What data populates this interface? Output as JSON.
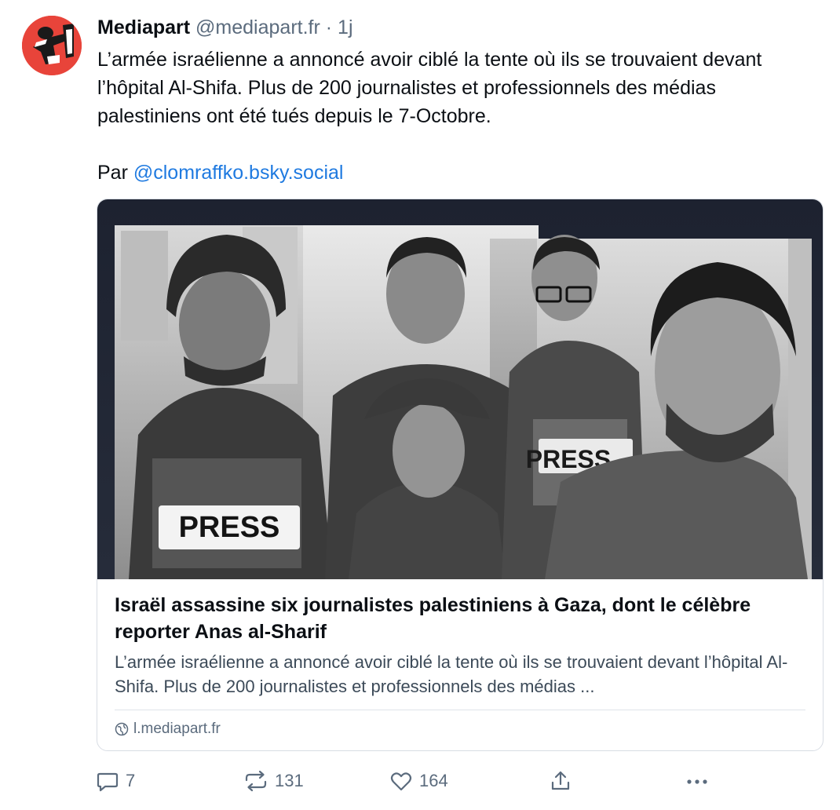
{
  "post": {
    "author_name": "Mediapart",
    "author_handle": "@mediapart.fr",
    "separator": "·",
    "time_ago": "1j",
    "text": "L’armée israélienne a annoncé avoir ciblé la tente où ils se trouvaient devant l’hôpital Al-Shifa. Plus de 200 journalistes et professionnels des médias palestiniens ont été tués depuis le 7-Octobre.",
    "by_prefix": "Par ",
    "mention": "@clomraffko.bsky.social"
  },
  "link_card": {
    "image_alt": "PRESS",
    "image_text_second": "PRESS",
    "title": "Israël assassine six journalistes palestiniens à Gaza, dont le célèbre reporter Anas al-Sharif",
    "description": "L’armée israélienne a annoncé avoir ciblé la tente où ils se trouvaient devant l’hôpital Al-Shifa. Plus de 200 journalistes et professionnels des médias ...",
    "domain": "l.mediapart.fr"
  },
  "actions": {
    "reply_count": "7",
    "repost_count": "131",
    "like_count": "164",
    "icons": [
      "reply-icon",
      "repost-icon",
      "like-icon",
      "share-icon",
      "more-icon"
    ]
  },
  "colors": {
    "avatar_bg": "#e8443a",
    "link": "#1f7ae0",
    "muted": "#5b6b7d"
  }
}
